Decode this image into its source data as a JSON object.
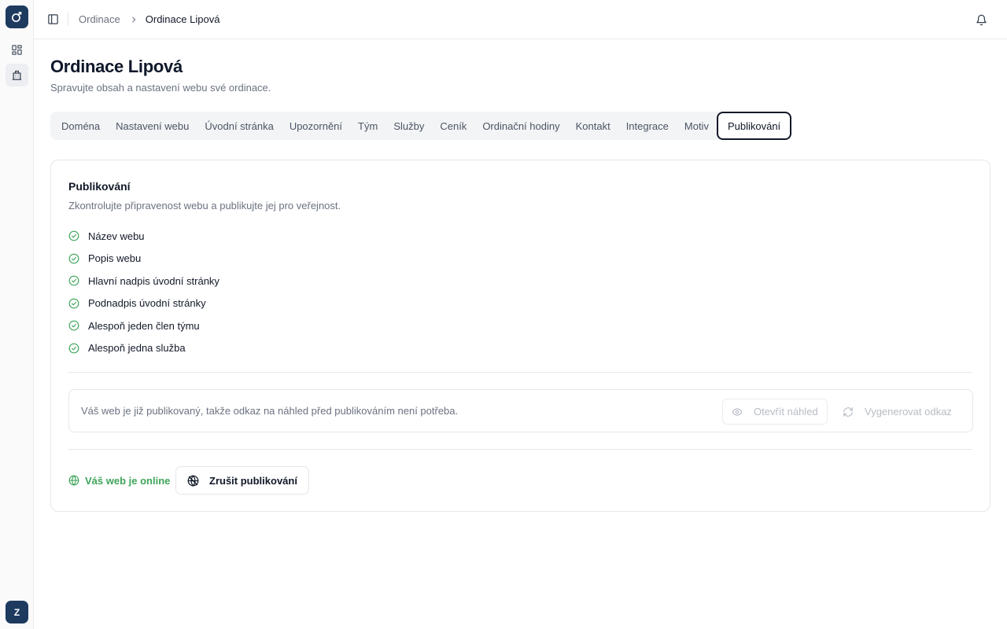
{
  "rail": {
    "items": [
      {
        "icon": "dashboard-grid-icon"
      },
      {
        "icon": "building-icon",
        "active": true
      }
    ],
    "avatar_initial": "Z"
  },
  "topbar": {
    "breadcrumb": {
      "parent": "Ordinace",
      "current": "Ordinace Lipová"
    }
  },
  "page": {
    "title": "Ordinace Lipová",
    "subtitle": "Spravujte obsah a nastavení webu své ordinace."
  },
  "tabs": [
    {
      "label": "Doména"
    },
    {
      "label": "Nastavení webu"
    },
    {
      "label": "Úvodní stránka"
    },
    {
      "label": "Upozornění"
    },
    {
      "label": "Tým"
    },
    {
      "label": "Služby"
    },
    {
      "label": "Ceník"
    },
    {
      "label": "Ordinační hodiny"
    },
    {
      "label": "Kontakt"
    },
    {
      "label": "Integrace"
    },
    {
      "label": "Motiv"
    },
    {
      "label": "Publikování",
      "active": true
    }
  ],
  "publish": {
    "title": "Publikování",
    "description": "Zkontrolujte připravenost webu a publikujte jej pro veřejnost.",
    "checklist": [
      {
        "label": "Název webu",
        "done": true
      },
      {
        "label": "Popis webu",
        "done": true
      },
      {
        "label": "Hlavní nadpis úvodní stránky",
        "done": true
      },
      {
        "label": "Podnadpis úvodní stránky",
        "done": true
      },
      {
        "label": "Alespoň jeden člen týmu",
        "done": true
      },
      {
        "label": "Alespoň jedna služba",
        "done": true
      }
    ],
    "preview": {
      "text": "Váš web je již publikovaný, takže odkaz na náhled před publikováním není potřeba.",
      "open_preview_label": "Otevřít náhled",
      "generate_link_label": "Vygenerovat odkaz"
    },
    "status_label": "Váš web je online",
    "unpublish_label": "Zrušit publikování"
  },
  "colors": {
    "brand": "#1e3a5f",
    "success": "#3fa55a",
    "muted_text": "#6b7280",
    "border": "#e5e7eb"
  }
}
